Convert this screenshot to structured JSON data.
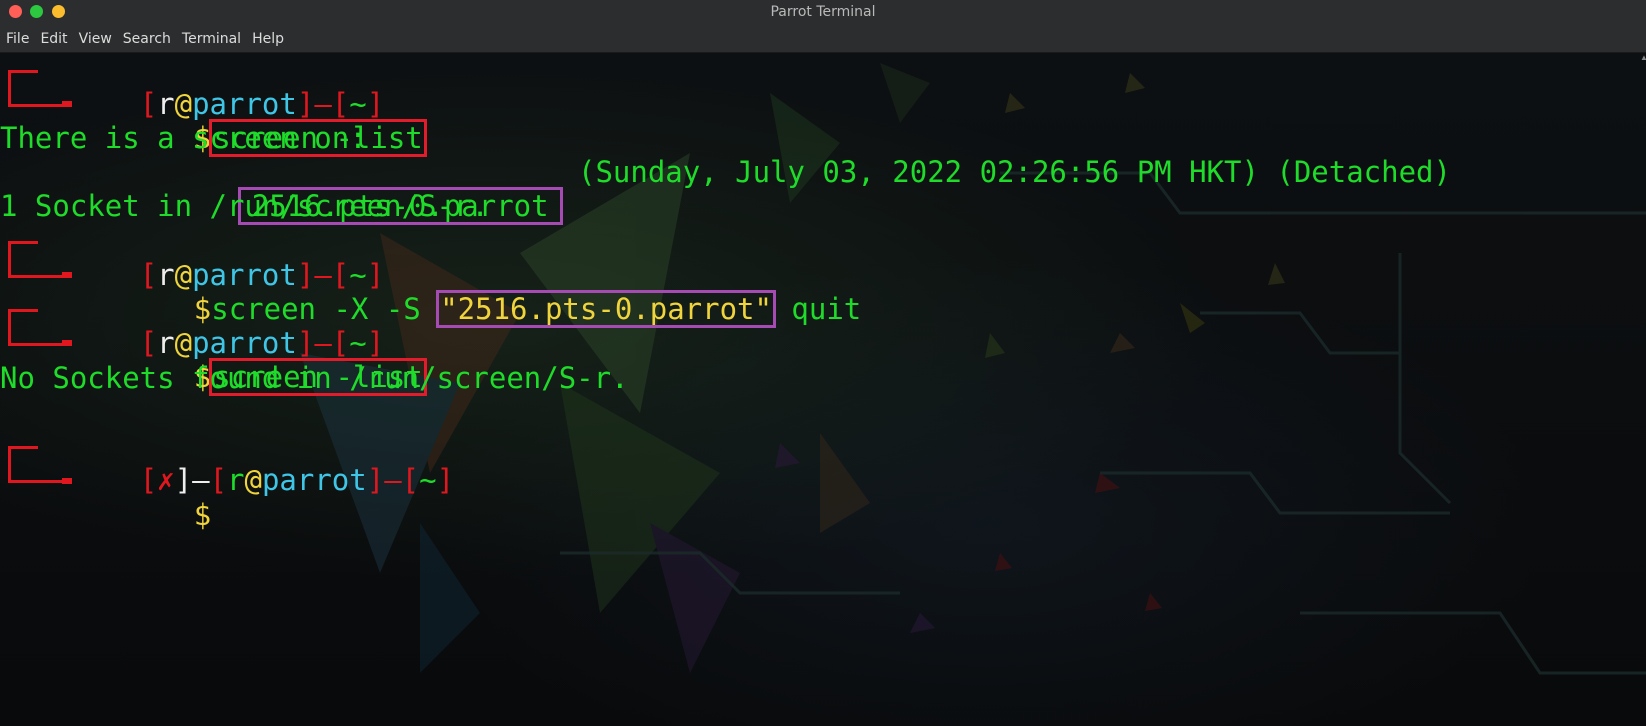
{
  "window": {
    "title": "Parrot Terminal"
  },
  "menu": [
    "File",
    "Edit",
    "View",
    "Search",
    "Terminal",
    "Help"
  ],
  "terminal": {
    "prompt1": {
      "open_bracket": "[",
      "user": "r",
      "at": "@",
      "host": "parrot",
      "close_bracket": "]",
      "dash": "—",
      "dir_open": "[",
      "dir": "~",
      "dir_close": "]",
      "dollar": "$",
      "command": "screen -list"
    },
    "output1": "There is a screen on:",
    "output2_session": "2516.pts-0.parrot",
    "output2_info": "(Sunday, July 03, 2022 02:26:56 PM HKT) (Detached)",
    "output3": "1 Socket in /run/screen/S-r.",
    "prompt2": {
      "user": "r",
      "at": "@",
      "host": "parrot",
      "dir": "~",
      "dollar": "$",
      "command_prefix": "screen -X -S ",
      "command_arg": "\"2516.pts-0.parrot\"",
      "command_suffix": " quit"
    },
    "prompt3": {
      "user": "r",
      "at": "@",
      "host": "parrot",
      "dir": "~",
      "dollar": "$",
      "command": "screen -list"
    },
    "output4": "No Sockets found in /run/screen/S-r.",
    "prompt4": {
      "status": "✗",
      "user": "r",
      "at": "@",
      "host": "parrot",
      "dir": "~",
      "dollar": "$"
    }
  },
  "colors": {
    "prompt_red": "#e0171f",
    "output_green": "#1fdc2a",
    "host_cyan": "#3fc5e6",
    "dollar_yellow": "#f0d43c",
    "highlight_red_box": "#e21c2b",
    "highlight_purple_box": "#a64ab4"
  }
}
